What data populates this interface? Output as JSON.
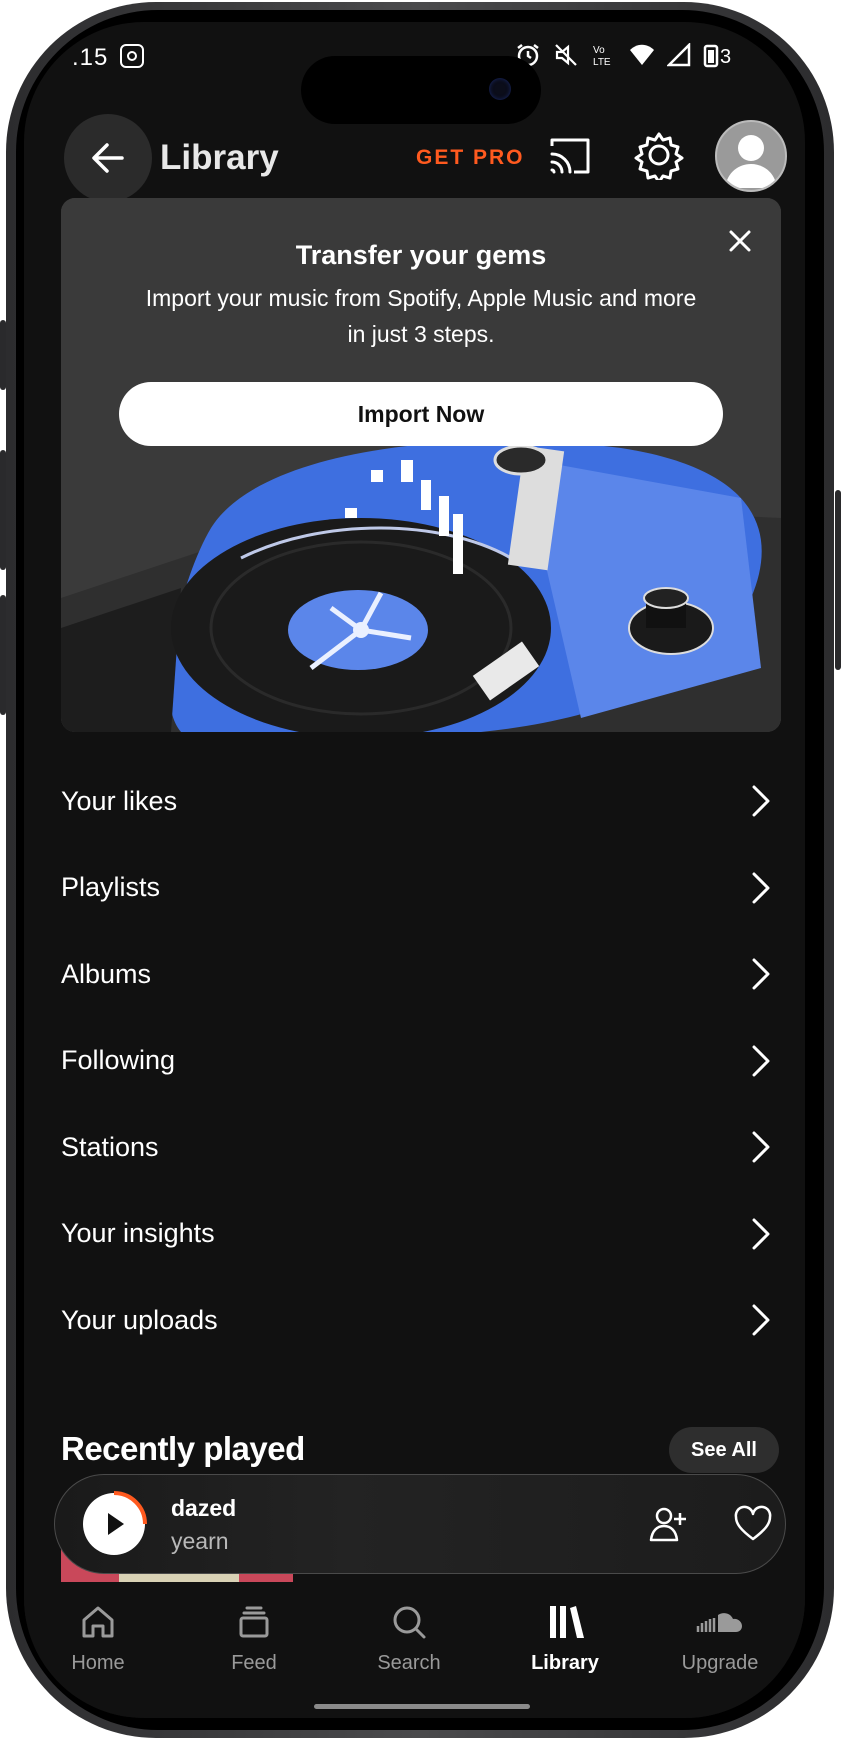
{
  "status_bar": {
    "time": ".15"
  },
  "header": {
    "title": "Library",
    "get_pro": "GET PRO"
  },
  "banner": {
    "title": "Transfer your gems",
    "text": "Import your music from Spotify, Apple Music and more in just 3 steps.",
    "button": "Import Now"
  },
  "library_items": [
    {
      "label": "Your likes"
    },
    {
      "label": "Playlists"
    },
    {
      "label": "Albums"
    },
    {
      "label": "Following"
    },
    {
      "label": "Stations"
    },
    {
      "label": "Your insights"
    },
    {
      "label": "Your uploads"
    }
  ],
  "recently_played": {
    "title": "Recently played",
    "see_all": "See All"
  },
  "mini_player": {
    "track": "dazed",
    "artist": "yearn"
  },
  "bottom_nav": {
    "items": [
      {
        "label": "Home",
        "icon": "home-icon"
      },
      {
        "label": "Feed",
        "icon": "feed-icon"
      },
      {
        "label": "Search",
        "icon": "search-icon"
      },
      {
        "label": "Library",
        "icon": "library-icon",
        "active": true
      },
      {
        "label": "Upgrade",
        "icon": "soundcloud-icon"
      }
    ]
  },
  "colors": {
    "accent": "#ff5a1f",
    "background": "#111111",
    "banner_blue": "#3e6fe0"
  }
}
